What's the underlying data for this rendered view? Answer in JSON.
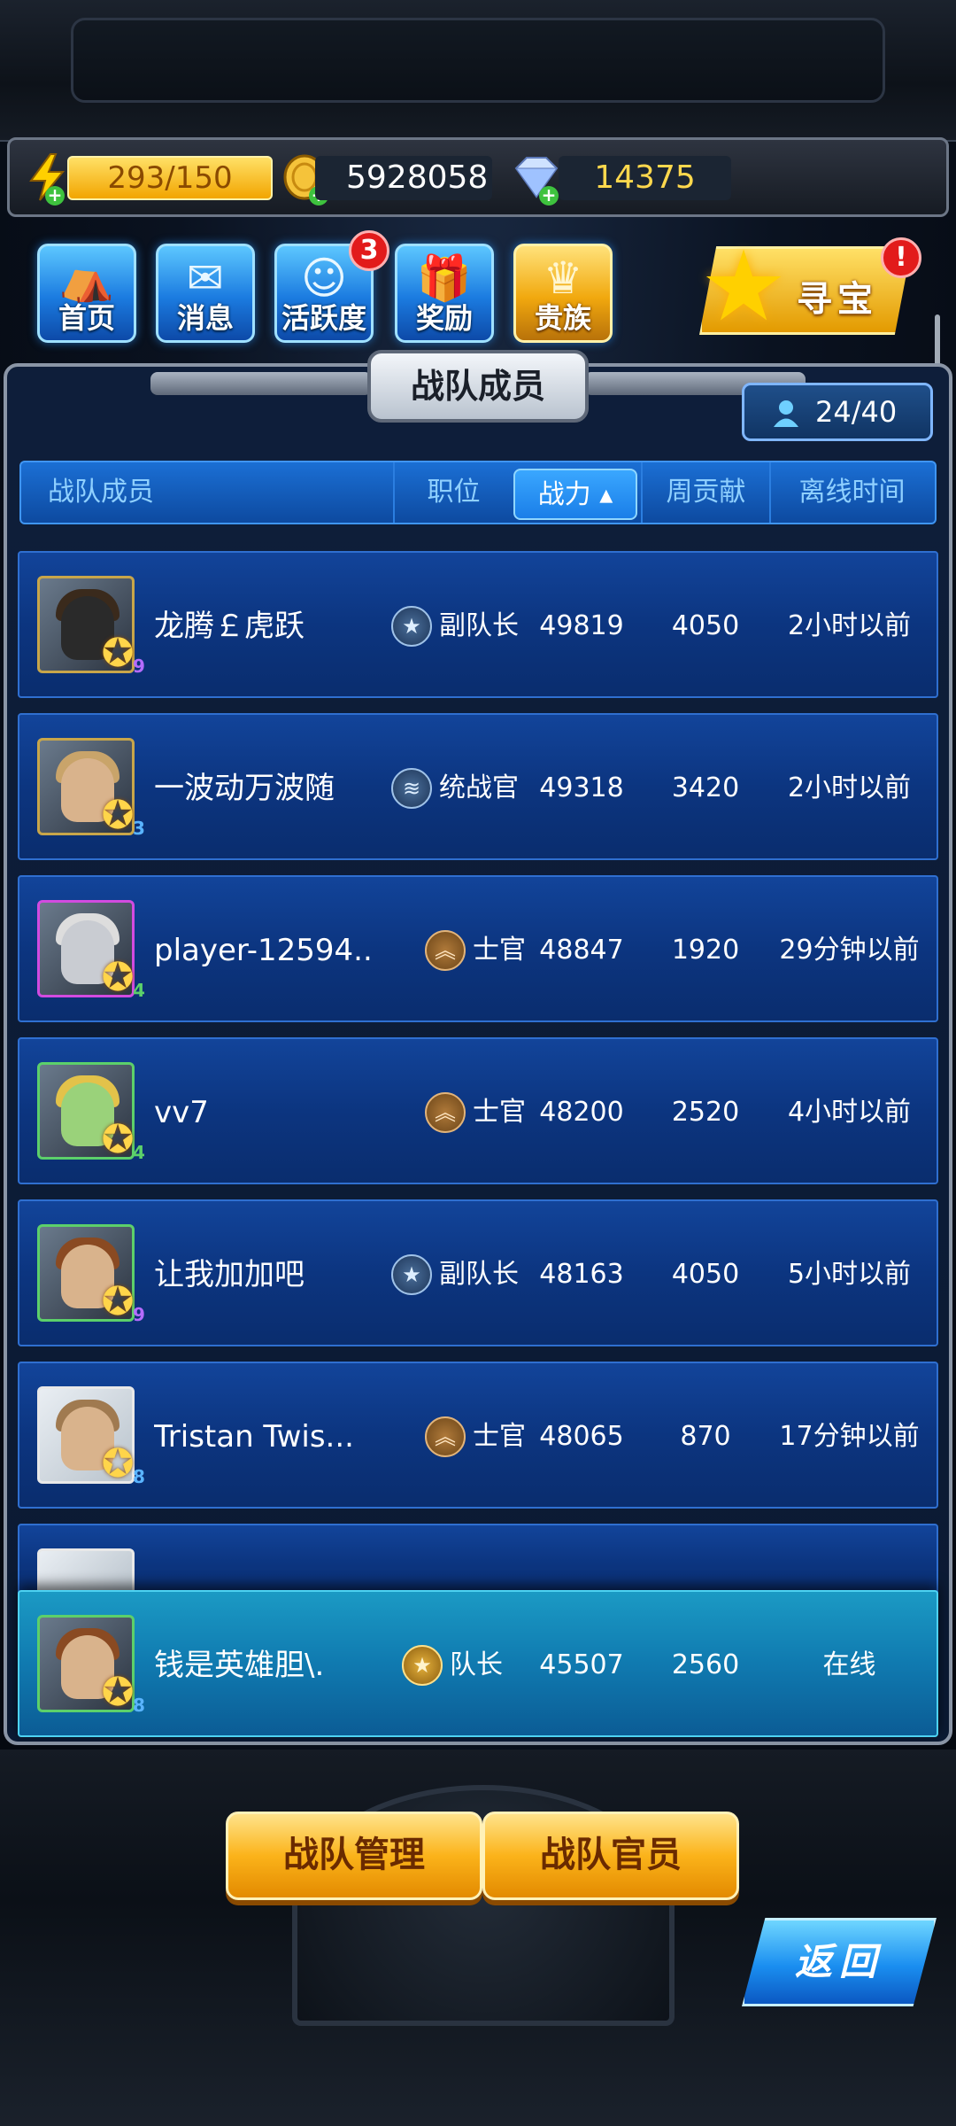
{
  "resources": {
    "energy": "293/150",
    "gold": "5928058",
    "gems": "14375"
  },
  "nav": {
    "home": "首页",
    "messages": "消息",
    "activity": "活跃度",
    "activity_badge": "3",
    "rewards": "奖励",
    "noble": "贵族",
    "treasure": "寻宝",
    "treasure_badge": "!"
  },
  "panel": {
    "title": "战队成员",
    "member_count": "24/40"
  },
  "table_header": {
    "member": "战队成员",
    "position": "职位",
    "power": "战力 ▴",
    "weekly": "周贡献",
    "offline": "离线时间"
  },
  "members": [
    {
      "name": "龙腾￡虎跃",
      "role": "副队长",
      "power": "49819",
      "weekly": "4050",
      "offline": "2小时以前",
      "level": "9"
    },
    {
      "name": "一波动万波随",
      "role": "统战官",
      "power": "49318",
      "weekly": "3420",
      "offline": "2小时以前",
      "level": "3"
    },
    {
      "name": "player-12594...",
      "role": "士官",
      "power": "48847",
      "weekly": "1920",
      "offline": "29分钟以前",
      "level": "4"
    },
    {
      "name": "vv7",
      "role": "士官",
      "power": "48200",
      "weekly": "2520",
      "offline": "4小时以前",
      "level": "4"
    },
    {
      "name": "让我加加吧",
      "role": "副队长",
      "power": "48163",
      "weekly": "4050",
      "offline": "5小时以前",
      "level": "9"
    },
    {
      "name": "Tristan Twis...",
      "role": "士官",
      "power": "48065",
      "weekly": "870",
      "offline": "17分钟以前",
      "level": "8"
    }
  ],
  "self_row": {
    "name": "钱是英雄胆\\.",
    "role": "队长",
    "power": "45507",
    "weekly": "2560",
    "offline": "在线",
    "level": "8"
  },
  "buttons": {
    "manage": "战队管理",
    "officers": "战队官员",
    "back": "返回"
  },
  "colors": {
    "gold_accent": "#f2a500",
    "blue_accent": "#1b7be0",
    "row_blue": "#0c3580",
    "self_row": "#107ab0"
  }
}
